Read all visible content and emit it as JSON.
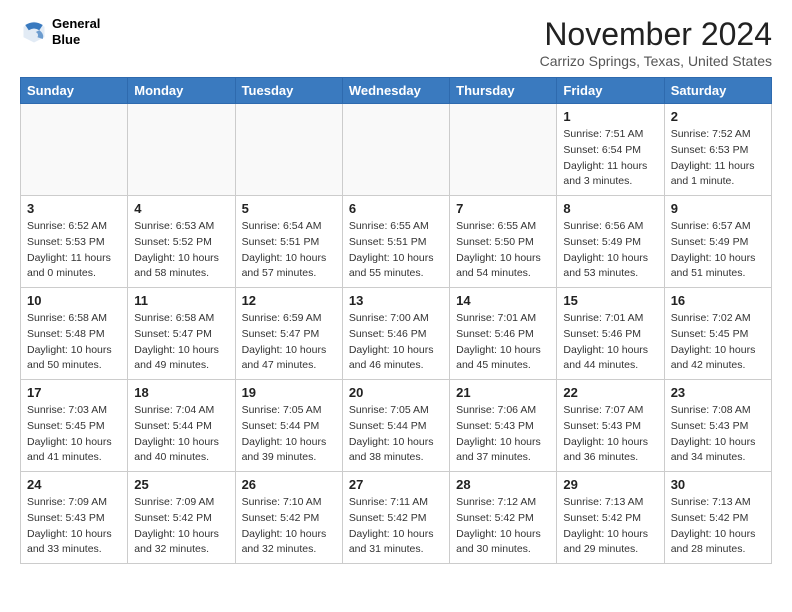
{
  "logo": {
    "line1": "General",
    "line2": "Blue"
  },
  "title": "November 2024",
  "location": "Carrizo Springs, Texas, United States",
  "weekdays": [
    "Sunday",
    "Monday",
    "Tuesday",
    "Wednesday",
    "Thursday",
    "Friday",
    "Saturday"
  ],
  "weeks": [
    [
      {
        "day": "",
        "info": ""
      },
      {
        "day": "",
        "info": ""
      },
      {
        "day": "",
        "info": ""
      },
      {
        "day": "",
        "info": ""
      },
      {
        "day": "",
        "info": ""
      },
      {
        "day": "1",
        "sunrise": "Sunrise: 7:51 AM",
        "sunset": "Sunset: 6:54 PM",
        "daylight": "Daylight: 11 hours and 3 minutes."
      },
      {
        "day": "2",
        "sunrise": "Sunrise: 7:52 AM",
        "sunset": "Sunset: 6:53 PM",
        "daylight": "Daylight: 11 hours and 1 minute."
      }
    ],
    [
      {
        "day": "3",
        "sunrise": "Sunrise: 6:52 AM",
        "sunset": "Sunset: 5:53 PM",
        "daylight": "Daylight: 11 hours and 0 minutes."
      },
      {
        "day": "4",
        "sunrise": "Sunrise: 6:53 AM",
        "sunset": "Sunset: 5:52 PM",
        "daylight": "Daylight: 10 hours and 58 minutes."
      },
      {
        "day": "5",
        "sunrise": "Sunrise: 6:54 AM",
        "sunset": "Sunset: 5:51 PM",
        "daylight": "Daylight: 10 hours and 57 minutes."
      },
      {
        "day": "6",
        "sunrise": "Sunrise: 6:55 AM",
        "sunset": "Sunset: 5:51 PM",
        "daylight": "Daylight: 10 hours and 55 minutes."
      },
      {
        "day": "7",
        "sunrise": "Sunrise: 6:55 AM",
        "sunset": "Sunset: 5:50 PM",
        "daylight": "Daylight: 10 hours and 54 minutes."
      },
      {
        "day": "8",
        "sunrise": "Sunrise: 6:56 AM",
        "sunset": "Sunset: 5:49 PM",
        "daylight": "Daylight: 10 hours and 53 minutes."
      },
      {
        "day": "9",
        "sunrise": "Sunrise: 6:57 AM",
        "sunset": "Sunset: 5:49 PM",
        "daylight": "Daylight: 10 hours and 51 minutes."
      }
    ],
    [
      {
        "day": "10",
        "sunrise": "Sunrise: 6:58 AM",
        "sunset": "Sunset: 5:48 PM",
        "daylight": "Daylight: 10 hours and 50 minutes."
      },
      {
        "day": "11",
        "sunrise": "Sunrise: 6:58 AM",
        "sunset": "Sunset: 5:47 PM",
        "daylight": "Daylight: 10 hours and 49 minutes."
      },
      {
        "day": "12",
        "sunrise": "Sunrise: 6:59 AM",
        "sunset": "Sunset: 5:47 PM",
        "daylight": "Daylight: 10 hours and 47 minutes."
      },
      {
        "day": "13",
        "sunrise": "Sunrise: 7:00 AM",
        "sunset": "Sunset: 5:46 PM",
        "daylight": "Daylight: 10 hours and 46 minutes."
      },
      {
        "day": "14",
        "sunrise": "Sunrise: 7:01 AM",
        "sunset": "Sunset: 5:46 PM",
        "daylight": "Daylight: 10 hours and 45 minutes."
      },
      {
        "day": "15",
        "sunrise": "Sunrise: 7:01 AM",
        "sunset": "Sunset: 5:46 PM",
        "daylight": "Daylight: 10 hours and 44 minutes."
      },
      {
        "day": "16",
        "sunrise": "Sunrise: 7:02 AM",
        "sunset": "Sunset: 5:45 PM",
        "daylight": "Daylight: 10 hours and 42 minutes."
      }
    ],
    [
      {
        "day": "17",
        "sunrise": "Sunrise: 7:03 AM",
        "sunset": "Sunset: 5:45 PM",
        "daylight": "Daylight: 10 hours and 41 minutes."
      },
      {
        "day": "18",
        "sunrise": "Sunrise: 7:04 AM",
        "sunset": "Sunset: 5:44 PM",
        "daylight": "Daylight: 10 hours and 40 minutes."
      },
      {
        "day": "19",
        "sunrise": "Sunrise: 7:05 AM",
        "sunset": "Sunset: 5:44 PM",
        "daylight": "Daylight: 10 hours and 39 minutes."
      },
      {
        "day": "20",
        "sunrise": "Sunrise: 7:05 AM",
        "sunset": "Sunset: 5:44 PM",
        "daylight": "Daylight: 10 hours and 38 minutes."
      },
      {
        "day": "21",
        "sunrise": "Sunrise: 7:06 AM",
        "sunset": "Sunset: 5:43 PM",
        "daylight": "Daylight: 10 hours and 37 minutes."
      },
      {
        "day": "22",
        "sunrise": "Sunrise: 7:07 AM",
        "sunset": "Sunset: 5:43 PM",
        "daylight": "Daylight: 10 hours and 36 minutes."
      },
      {
        "day": "23",
        "sunrise": "Sunrise: 7:08 AM",
        "sunset": "Sunset: 5:43 PM",
        "daylight": "Daylight: 10 hours and 34 minutes."
      }
    ],
    [
      {
        "day": "24",
        "sunrise": "Sunrise: 7:09 AM",
        "sunset": "Sunset: 5:43 PM",
        "daylight": "Daylight: 10 hours and 33 minutes."
      },
      {
        "day": "25",
        "sunrise": "Sunrise: 7:09 AM",
        "sunset": "Sunset: 5:42 PM",
        "daylight": "Daylight: 10 hours and 32 minutes."
      },
      {
        "day": "26",
        "sunrise": "Sunrise: 7:10 AM",
        "sunset": "Sunset: 5:42 PM",
        "daylight": "Daylight: 10 hours and 32 minutes."
      },
      {
        "day": "27",
        "sunrise": "Sunrise: 7:11 AM",
        "sunset": "Sunset: 5:42 PM",
        "daylight": "Daylight: 10 hours and 31 minutes."
      },
      {
        "day": "28",
        "sunrise": "Sunrise: 7:12 AM",
        "sunset": "Sunset: 5:42 PM",
        "daylight": "Daylight: 10 hours and 30 minutes."
      },
      {
        "day": "29",
        "sunrise": "Sunrise: 7:13 AM",
        "sunset": "Sunset: 5:42 PM",
        "daylight": "Daylight: 10 hours and 29 minutes."
      },
      {
        "day": "30",
        "sunrise": "Sunrise: 7:13 AM",
        "sunset": "Sunset: 5:42 PM",
        "daylight": "Daylight: 10 hours and 28 minutes."
      }
    ]
  ]
}
